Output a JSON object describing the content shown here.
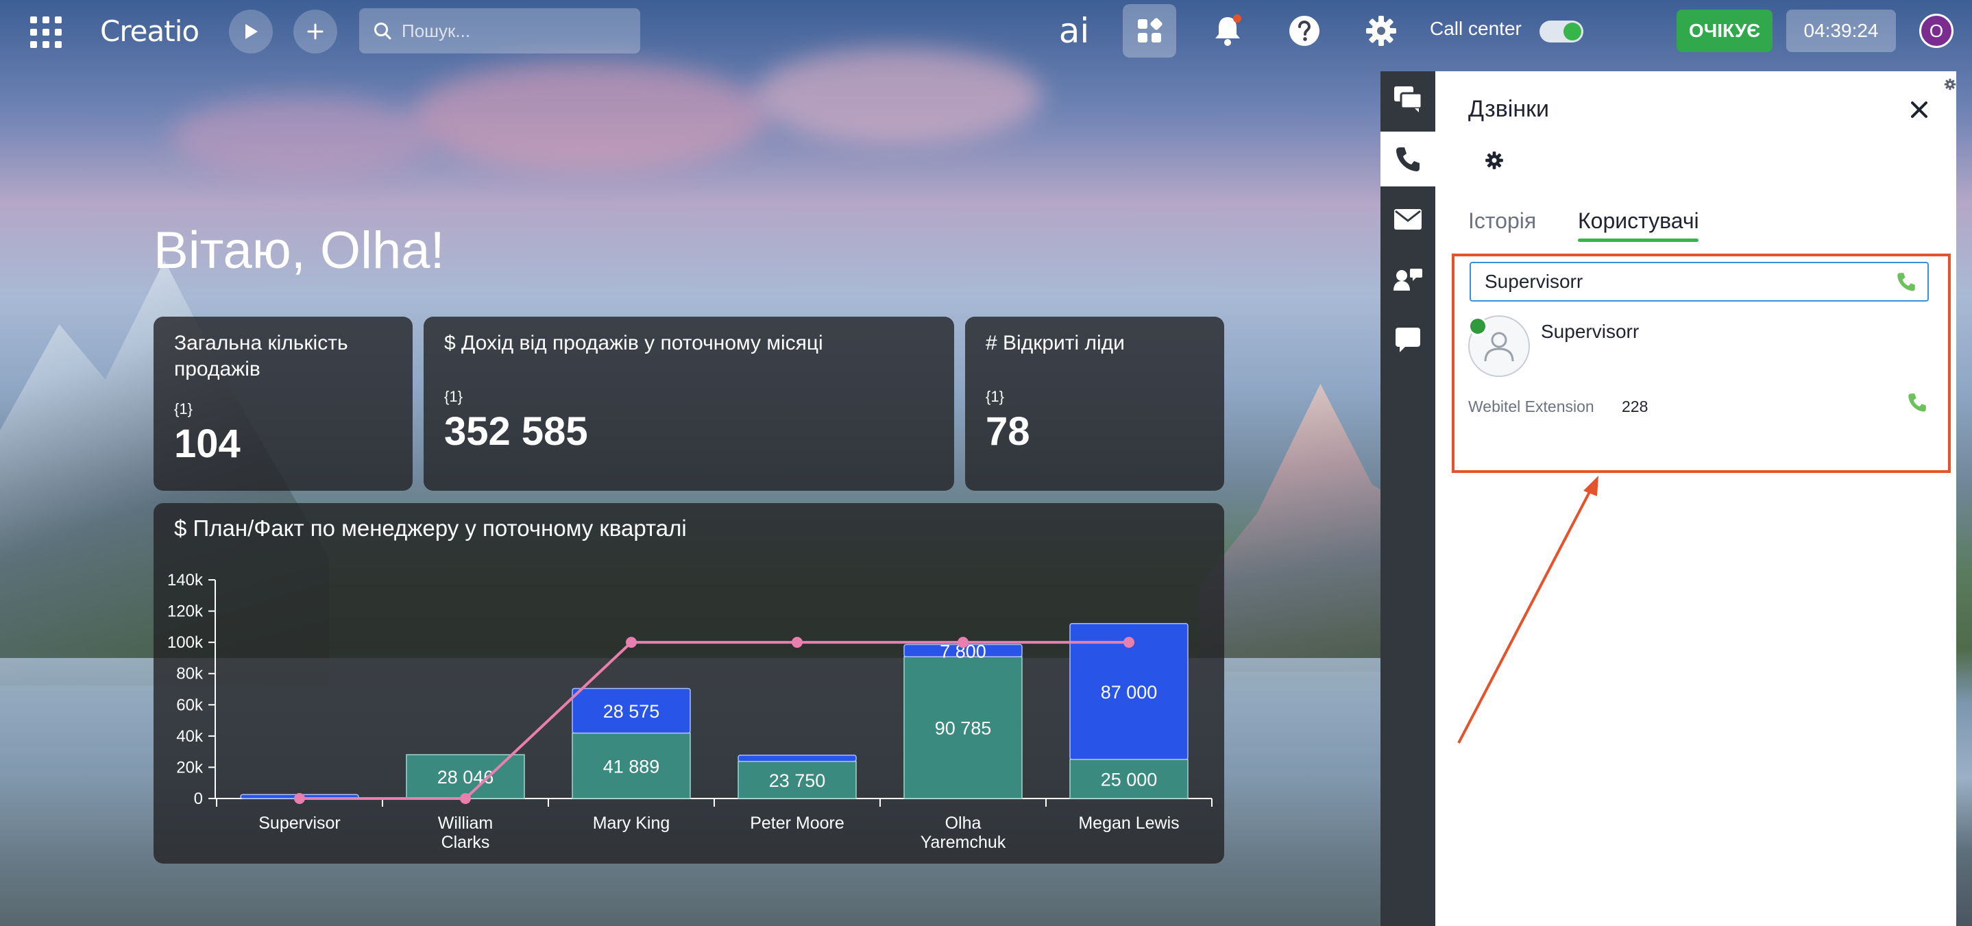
{
  "topbar": {
    "logo_text": "Creatio",
    "search_placeholder": "Пошук...",
    "ai_label": "ai",
    "call_center_label": "Call center",
    "status_label": "ОЧІКУЄ",
    "timer": "04:39:24",
    "avatar_letter": "O",
    "accent_green": "#30a84b",
    "notification_dot_color": "#e4532c"
  },
  "greeting": "Вітаю, Olha!",
  "widgets": {
    "total_sales": {
      "title_line1": "Загальна кількість",
      "title_line2": "продажів",
      "sub": "{1}",
      "value": "104"
    },
    "revenue": {
      "title": "$ Дохід від продажів у поточному місяці",
      "sub": "{1}",
      "value": "352 585"
    },
    "open_leads": {
      "title": "# Відкриті ліди",
      "sub": "{1}",
      "value": "78"
    }
  },
  "chart_data": {
    "type": "bar",
    "title": "$ План/Факт по менеджеру у поточному кварталі",
    "categories": [
      "Supervisor",
      "William Clarks",
      "Mary King",
      "Peter Moore",
      "Olha Yaremchuk",
      "Megan Lewis"
    ],
    "category_lines": [
      [
        "Supervisor"
      ],
      [
        "William",
        "Clarks"
      ],
      [
        "Mary King"
      ],
      [
        "Peter Moore"
      ],
      [
        "Olha",
        "Yaremchuk"
      ],
      [
        "Megan Lewis"
      ]
    ],
    "series": [
      {
        "values": [
          0,
          28046,
          41889,
          23750,
          90785,
          25000
        ],
        "labels": [
          "",
          "28 046",
          "41 889",
          "23 750",
          "90 785",
          "25 000"
        ],
        "color": "#3a8a80"
      },
      {
        "values": [
          2500,
          0,
          28575,
          4000,
          7800,
          87000
        ],
        "labels": [
          "",
          "",
          "28 575",
          "",
          "7 800",
          "87 000"
        ],
        "color": "#2854e8"
      },
      {
        "type": "line",
        "values": [
          0,
          0,
          100000,
          100000,
          100000,
          100000
        ],
        "color": "#e87fae"
      }
    ],
    "ylim": [
      0,
      140000
    ],
    "yticks": [
      "0",
      "20k",
      "40k",
      "60k",
      "80k",
      "100k",
      "120k",
      "140k"
    ],
    "stacked": true,
    "grid": false
  },
  "sidebar": {
    "items": [
      "chat-icon",
      "phone-icon",
      "email-icon",
      "contacts-icon",
      "message-icon"
    ],
    "active": "phone-icon"
  },
  "panel": {
    "title": "Дзвінки",
    "tabs": [
      {
        "label": "Історія",
        "active": false
      },
      {
        "label": "Користувачі",
        "active": true
      }
    ],
    "search_value": "Supervisorr",
    "user": {
      "name": "Supervisorr",
      "status": "online",
      "ext_label": "Webitel Extension",
      "ext_value": "228"
    },
    "highlight_color": "#e4532c"
  }
}
